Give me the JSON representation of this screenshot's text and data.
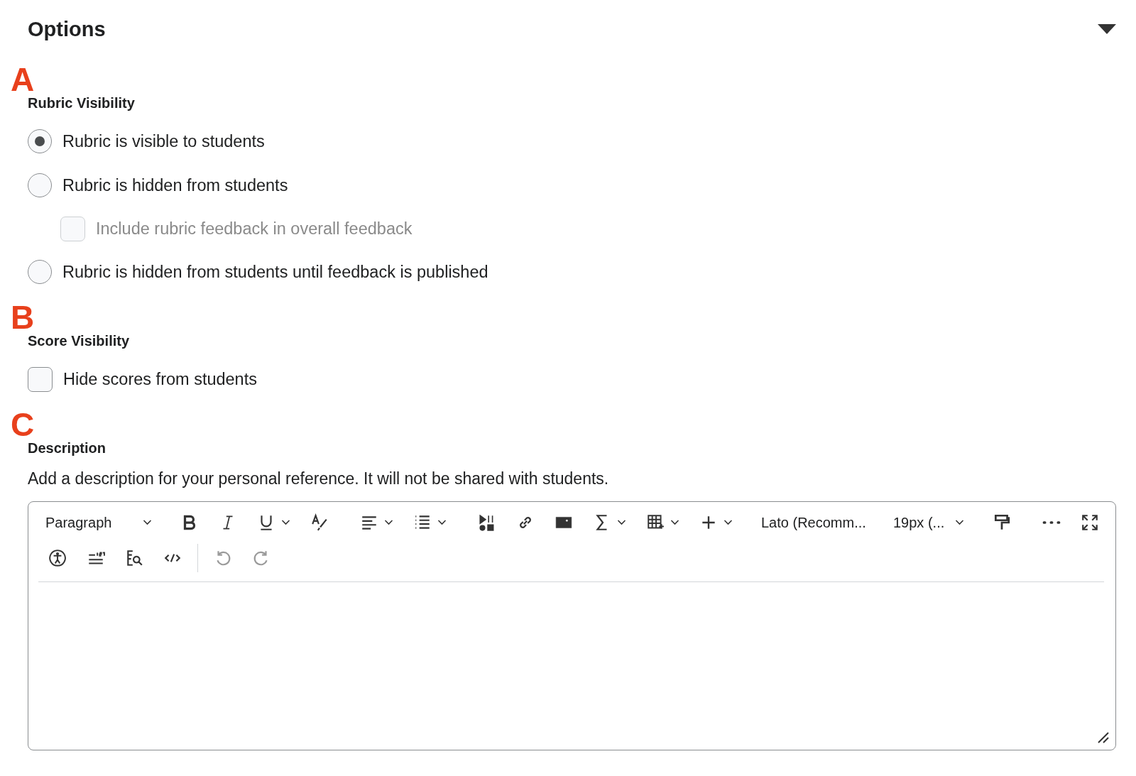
{
  "header": {
    "title": "Options",
    "expanded": true
  },
  "sections": [
    {
      "marker": "A",
      "label": "Rubric Visibility",
      "items": [
        {
          "kind": "radio",
          "label": "Rubric is visible to students",
          "selected": true,
          "disabled": false
        },
        {
          "kind": "radio",
          "label": "Rubric is hidden from students",
          "selected": false,
          "disabled": false,
          "children": [
            {
              "kind": "checkbox",
              "label": "Include rubric feedback in overall feedback",
              "checked": false,
              "disabled": true
            }
          ]
        },
        {
          "kind": "radio",
          "label": "Rubric is hidden from students until feedback is published",
          "selected": false,
          "disabled": false
        }
      ]
    },
    {
      "marker": "B",
      "label": "Score Visibility",
      "items": [
        {
          "kind": "checkbox",
          "label": "Hide scores from students",
          "checked": false,
          "disabled": false
        }
      ]
    }
  ],
  "description": {
    "marker": "C",
    "label": "Description",
    "help": "Add a description for your personal reference. It will not be shared with students.",
    "toolbar": [
      [
        {
          "kind": "select",
          "label": "Paragraph",
          "wide": true
        },
        {
          "kind": "separator"
        },
        {
          "kind": "bold",
          "dropdown": false,
          "disabled": false
        },
        {
          "kind": "italic",
          "dropdown": false,
          "disabled": false
        },
        {
          "kind": "underline",
          "dropdown": true,
          "disabled": false
        },
        {
          "kind": "format-painter-text",
          "dropdown": false,
          "disabled": false
        },
        {
          "kind": "separator"
        },
        {
          "kind": "align",
          "dropdown": true,
          "disabled": false
        },
        {
          "kind": "list",
          "dropdown": true,
          "disabled": false
        },
        {
          "kind": "separator"
        },
        {
          "kind": "media",
          "dropdown": false,
          "disabled": false
        },
        {
          "kind": "link",
          "dropdown": false,
          "disabled": false
        },
        {
          "kind": "image",
          "dropdown": false,
          "disabled": false
        },
        {
          "kind": "sigma",
          "dropdown": true,
          "disabled": false
        },
        {
          "kind": "table",
          "dropdown": true,
          "disabled": false
        },
        {
          "kind": "plus",
          "dropdown": true,
          "disabled": false
        },
        {
          "kind": "separator"
        },
        {
          "kind": "select",
          "label": "Lato (Recomm...",
          "wide": true
        },
        {
          "kind": "separator"
        },
        {
          "kind": "select",
          "label": "19px (...",
          "wide": false
        },
        {
          "kind": "separator"
        },
        {
          "kind": "roller",
          "dropdown": false,
          "disabled": false
        },
        {
          "kind": "separator"
        },
        {
          "kind": "more",
          "dropdown": false,
          "disabled": false
        },
        {
          "kind": "fullscreen",
          "dropdown": false,
          "disabled": false
        }
      ],
      [
        {
          "kind": "accessibility",
          "dropdown": false,
          "disabled": false
        },
        {
          "kind": "wordcount",
          "dropdown": false,
          "disabled": false
        },
        {
          "kind": "preview",
          "dropdown": false,
          "disabled": false
        },
        {
          "kind": "code",
          "dropdown": false,
          "disabled": false
        },
        {
          "kind": "separator"
        },
        {
          "kind": "undo",
          "dropdown": false,
          "disabled": true
        },
        {
          "kind": "redo",
          "dropdown": false,
          "disabled": true
        }
      ]
    ]
  }
}
